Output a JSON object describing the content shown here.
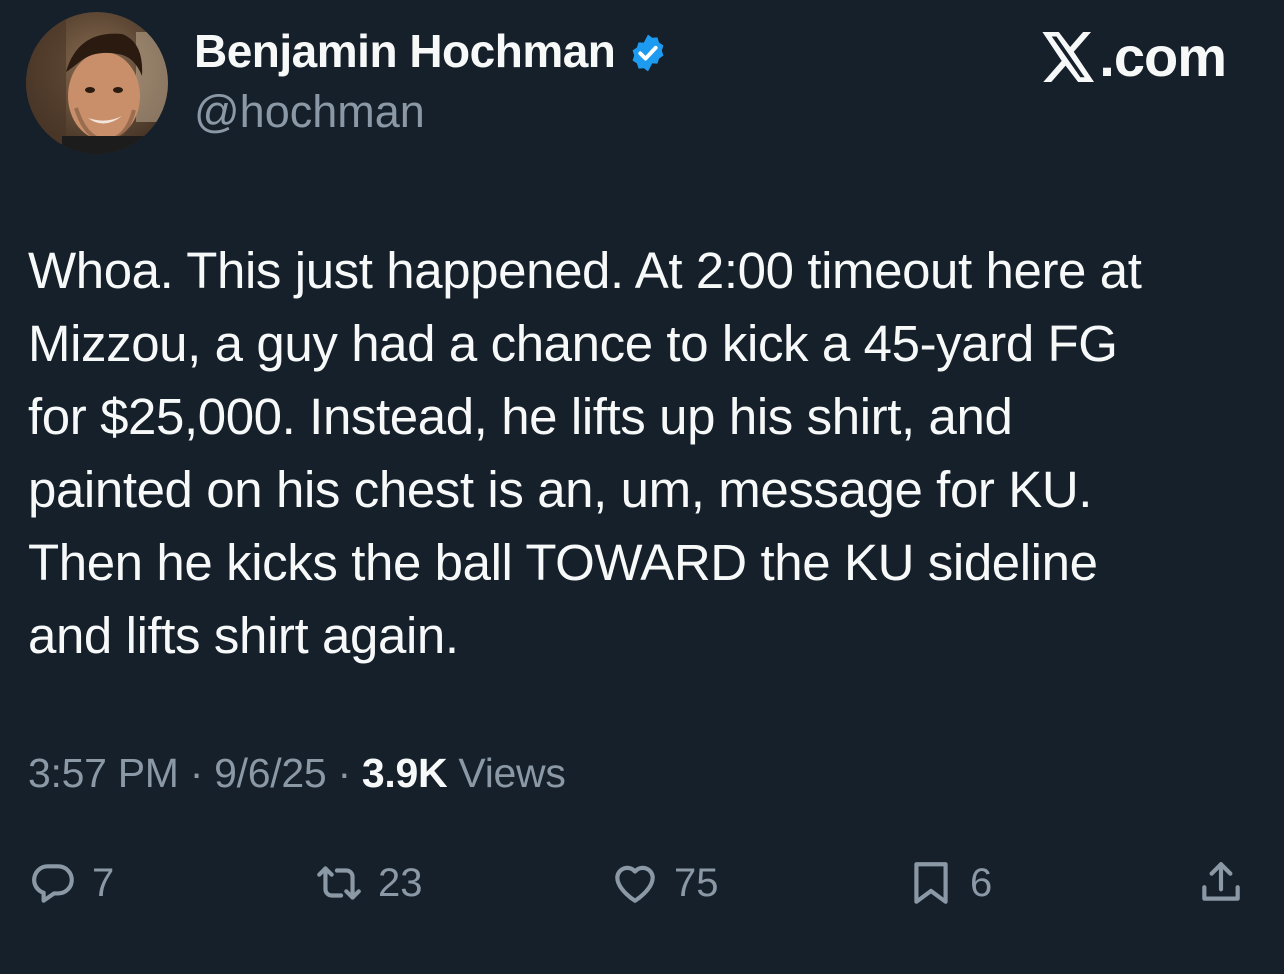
{
  "author": {
    "display_name": "Benjamin Hochman",
    "handle": "@hochman",
    "verified": true
  },
  "brand": {
    "label": ".com"
  },
  "tweet": {
    "text": "Whoa. This just happened. At 2:00 timeout here at\nMizzou, a guy had a chance to kick a 45-yard FG\nfor $25,000. Instead, he lifts up his shirt, and\npainted on his chest is an, um, message for KU.\nThen he kicks the ball TOWARD the KU sideline\nand lifts shirt again.",
    "time": "3:57 PM",
    "separator": "·",
    "date": "9/6/25",
    "views_count": "3.9K",
    "views_label": "Views"
  },
  "actions": {
    "replies": "7",
    "reposts": "23",
    "likes": "75",
    "bookmarks": "6"
  },
  "icons": {
    "reply": "reply-icon",
    "repost": "repost-icon",
    "like": "heart-icon",
    "bookmark": "bookmark-icon",
    "share": "share-icon",
    "verified": "verified-badge-icon"
  },
  "colors": {
    "background": "#15202b",
    "text_primary": "#f7f9f9",
    "text_secondary": "#8b98a5",
    "verified_blue": "#1d9bf0"
  }
}
